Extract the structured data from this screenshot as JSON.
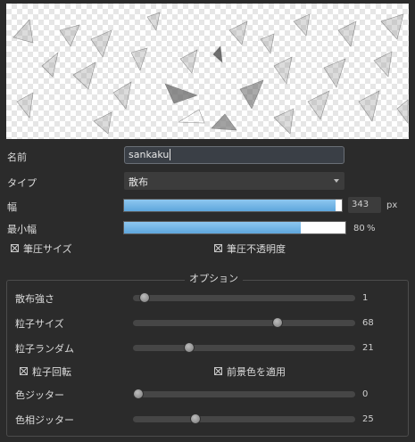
{
  "brush": {
    "name_label": "名前",
    "name_value": "sankaku",
    "type_label": "タイプ",
    "type_value": "散布",
    "width_label": "幅",
    "width_value": "343",
    "width_unit": "px",
    "width_fraction": 0.97,
    "min_width_label": "最小幅",
    "min_width_value": "80",
    "min_width_unit": "%",
    "min_width_fraction": 0.8,
    "pressure_size_label": "筆圧サイズ",
    "pressure_size_checked": true,
    "pressure_opacity_label": "筆圧不透明度",
    "pressure_opacity_checked": true
  },
  "options": {
    "title": "オプション",
    "scatter_strength": {
      "label": "散布強さ",
      "value": "1",
      "fraction": 0.03
    },
    "particle_size": {
      "label": "粒子サイズ",
      "value": "68",
      "fraction": 0.66
    },
    "particle_random": {
      "label": "粒子ランダム",
      "value": "21",
      "fraction": 0.24
    },
    "particle_rotate_label": "粒子回転",
    "particle_rotate_checked": true,
    "apply_foreground_label": "前景色を適用",
    "apply_foreground_checked": true,
    "color_jitter": {
      "label": "色ジッター",
      "value": "0",
      "fraction": 0.0
    },
    "hue_jitter": {
      "label": "色相ジッター",
      "value": "25",
      "fraction": 0.27
    }
  }
}
